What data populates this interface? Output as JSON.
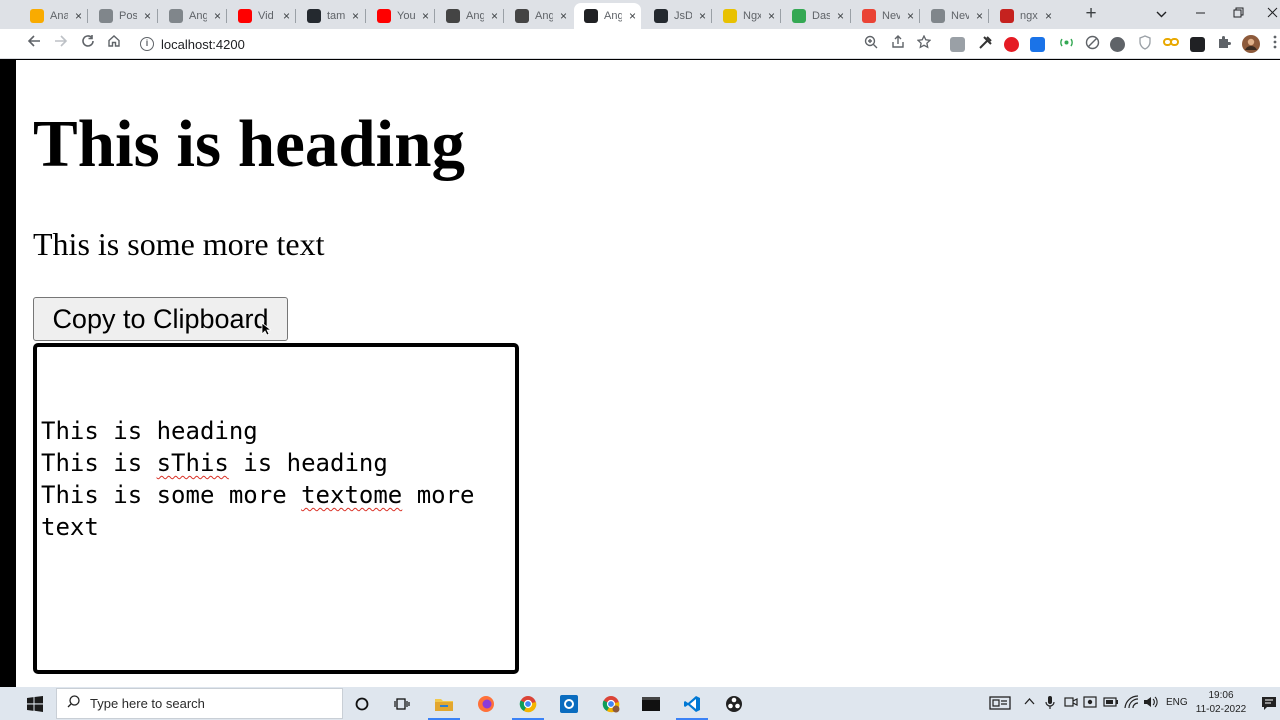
{
  "tabs": [
    {
      "title": "Ana",
      "fav_color": "#f9ab00"
    },
    {
      "title": "Pos",
      "fav_color": "#80868b"
    },
    {
      "title": "Ang",
      "fav_color": "#80868b"
    },
    {
      "title": "Vid",
      "fav_color": "#ff0000"
    },
    {
      "title": "tam",
      "fav_color": "#24292f"
    },
    {
      "title": "You",
      "fav_color": "#ff0000"
    },
    {
      "title": "Ang",
      "fav_color": "#444"
    },
    {
      "title": "Ang",
      "fav_color": "#444"
    },
    {
      "title": "Ang",
      "fav_color": "#202124"
    },
    {
      "title": "JsD",
      "fav_color": "#24292f"
    },
    {
      "title": "Ngx",
      "fav_color": "#e8c100"
    },
    {
      "title": "Das",
      "fav_color": "#34a853"
    },
    {
      "title": "Nev",
      "fav_color": "#ea4335"
    },
    {
      "title": "Nev",
      "fav_color": "#80868b"
    },
    {
      "title": "ngx",
      "fav_color": "#c5221f"
    }
  ],
  "active_tab_index": 8,
  "tab_close_glyph": "×",
  "newtab_glyph": "+",
  "omnibox": {
    "url": "localhost:4200"
  },
  "page": {
    "heading": "This is heading",
    "paragraph": "This is some more text",
    "copy_button_label": "Copy to Clipboard",
    "textarea_lines": [
      {
        "plain_before": "This is heading",
        "squiggle": "",
        "plain_after": ""
      },
      {
        "plain_before": "This is ",
        "squiggle": "sThis",
        "plain_after": " is heading"
      },
      {
        "plain_before": "This is some more ",
        "squiggle": "textome",
        "plain_after": " more"
      },
      {
        "plain_before": "text",
        "squiggle": "",
        "plain_after": ""
      }
    ]
  },
  "taskbar": {
    "search_placeholder": "Type here to search",
    "language": "ENG",
    "time": "19:06",
    "date": "11-02-2022"
  },
  "colors": {
    "spellcheck": "#d93025",
    "taskbar_bg": "#dfe6ee",
    "tabstrip_bg": "#dee1e6"
  }
}
